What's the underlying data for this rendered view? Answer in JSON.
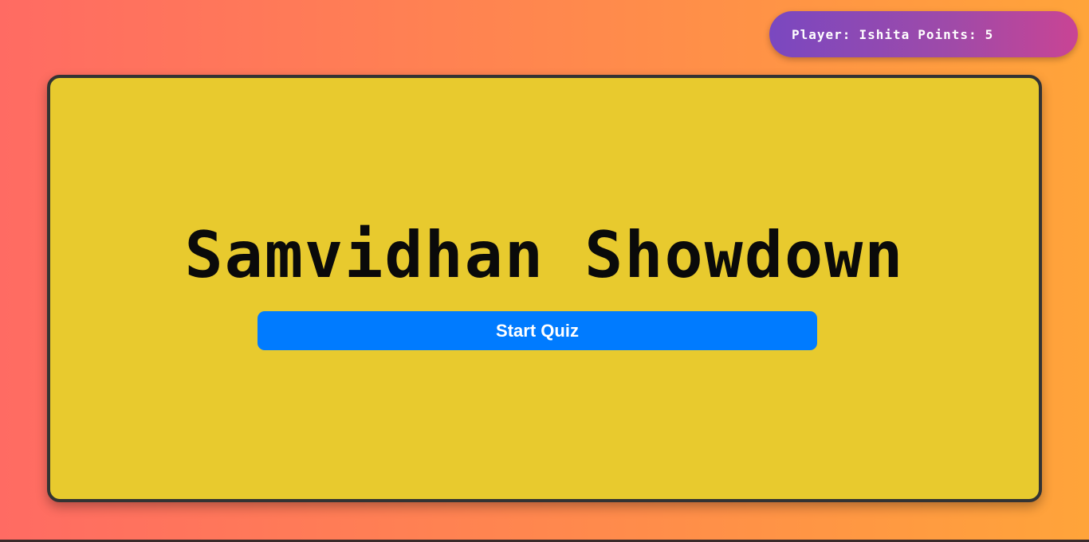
{
  "player": {
    "label": "Player:",
    "name": "Ishita",
    "points_label": "Points:",
    "points": "5"
  },
  "main": {
    "title": "Samvidhan Showdown",
    "start_button": "Start Quiz"
  },
  "colors": {
    "panel": "#e8ca2e",
    "button": "#007bff",
    "badge_start": "#7a48c0",
    "badge_end": "#c94494"
  }
}
